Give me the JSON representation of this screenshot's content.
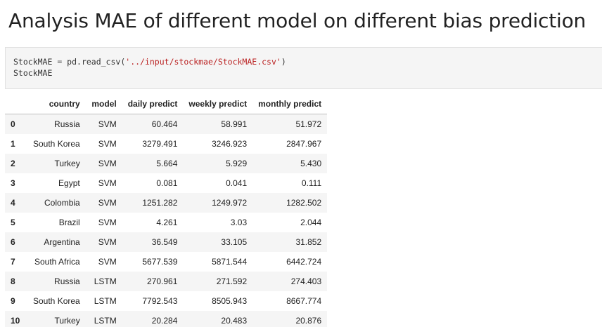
{
  "heading": "Analysis MAE of different model on different bias prediction",
  "code": {
    "line1_var": "StockMAE",
    "line1_op": " = ",
    "line1_call": "pd.read_csv(",
    "line1_str": "'../input/stockmae/StockMAE.csv'",
    "line1_close": ")",
    "line2": "StockMAE"
  },
  "table": {
    "columns": [
      "",
      "country",
      "model",
      "daily predict",
      "weekly predict",
      "monthly predict"
    ],
    "rows": [
      {
        "index": "0",
        "country": "Russia",
        "model": "SVM",
        "daily": "60.464",
        "weekly": "58.991",
        "monthly": "51.972"
      },
      {
        "index": "1",
        "country": "South Korea",
        "model": "SVM",
        "daily": "3279.491",
        "weekly": "3246.923",
        "monthly": "2847.967"
      },
      {
        "index": "2",
        "country": "Turkey",
        "model": "SVM",
        "daily": "5.664",
        "weekly": "5.929",
        "monthly": "5.430"
      },
      {
        "index": "3",
        "country": "Egypt",
        "model": "SVM",
        "daily": "0.081",
        "weekly": "0.041",
        "monthly": "0.111"
      },
      {
        "index": "4",
        "country": "Colombia",
        "model": "SVM",
        "daily": "1251.282",
        "weekly": "1249.972",
        "monthly": "1282.502"
      },
      {
        "index": "5",
        "country": "Brazil",
        "model": "SVM",
        "daily": "4.261",
        "weekly": "3.03",
        "monthly": "2.044"
      },
      {
        "index": "6",
        "country": "Argentina",
        "model": "SVM",
        "daily": "36.549",
        "weekly": "33.105",
        "monthly": "31.852"
      },
      {
        "index": "7",
        "country": "South Africa",
        "model": "SVM",
        "daily": "5677.539",
        "weekly": "5871.544",
        "monthly": "6442.724"
      },
      {
        "index": "8",
        "country": "Russia",
        "model": "LSTM",
        "daily": "270.961",
        "weekly": "271.592",
        "monthly": "274.403"
      },
      {
        "index": "9",
        "country": "South Korea",
        "model": "LSTM",
        "daily": "7792.543",
        "weekly": "8505.943",
        "monthly": "8667.774"
      },
      {
        "index": "10",
        "country": "Turkey",
        "model": "LSTM",
        "daily": "20.284",
        "weekly": "20.483",
        "monthly": "20.876"
      }
    ]
  }
}
